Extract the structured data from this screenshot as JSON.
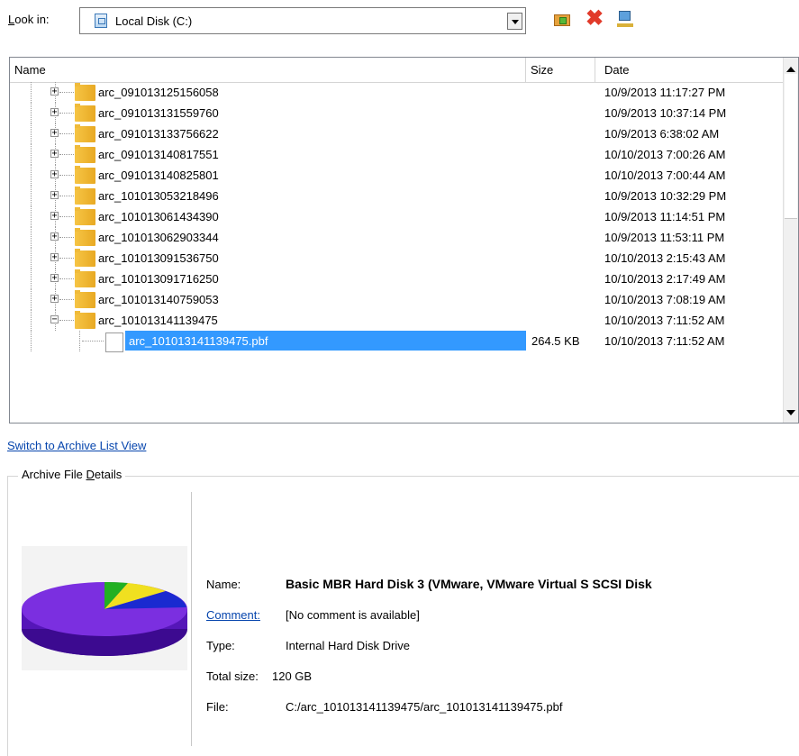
{
  "toolbar": {
    "look_in_label_prefix": "L",
    "look_in_label_rest": "ook in:",
    "look_in_value": "Local Disk (C:)",
    "icons": [
      "new-folder-icon",
      "delete-icon",
      "network-icon"
    ]
  },
  "list": {
    "columns": {
      "name": "Name",
      "size": "Size",
      "date": "Date"
    },
    "folders": [
      {
        "name": "arc_091013125156058",
        "date": "10/9/2013 11:17:27 PM"
      },
      {
        "name": "arc_091013131559760",
        "date": "10/9/2013 10:37:14 PM"
      },
      {
        "name": "arc_091013133756622",
        "date": "10/9/2013 6:38:02 AM"
      },
      {
        "name": "arc_091013140817551",
        "date": "10/10/2013 7:00:26 AM"
      },
      {
        "name": "arc_091013140825801",
        "date": "10/10/2013 7:00:44 AM"
      },
      {
        "name": "arc_101013053218496",
        "date": "10/9/2013 10:32:29 PM"
      },
      {
        "name": "arc_101013061434390",
        "date": "10/9/2013 11:14:51 PM"
      },
      {
        "name": "arc_101013062903344",
        "date": "10/9/2013 11:53:11 PM"
      },
      {
        "name": "arc_101013091536750",
        "date": "10/10/2013 2:15:43 AM"
      },
      {
        "name": "arc_101013091716250",
        "date": "10/10/2013 2:17:49 AM"
      },
      {
        "name": "arc_101013140759053",
        "date": "10/10/2013 7:08:19 AM"
      },
      {
        "name": "arc_101013141139475",
        "date": "10/10/2013 7:11:52 AM",
        "expanded": true
      }
    ],
    "selected_file": {
      "name": "arc_101013141139475.pbf",
      "size": "264.5 KB",
      "date": "10/10/2013 7:11:52 AM"
    }
  },
  "switch_link": "Switch to Archive List View",
  "details": {
    "title_prefix": "Archive File ",
    "title_underlined": "D",
    "title_rest": "etails",
    "name_label": "Name:",
    "name_value": "Basic MBR Hard Disk 3 (VMware, VMware Virtual S SCSI Disk",
    "comment_label": "Comment:",
    "comment_value": "[No comment is available]",
    "type_label": "Type:",
    "type_value": "Internal Hard Disk Drive",
    "total_label": "Total size:",
    "total_value": "120 GB",
    "file_label": "File:",
    "file_value": "C:/arc_101013141139475/arc_101013141139475.pbf",
    "disk_icon": "disk-pie-icon",
    "pie_colors": [
      "#7b2fe0",
      "#22b022",
      "#f0e020",
      "#1a2ad0"
    ]
  }
}
